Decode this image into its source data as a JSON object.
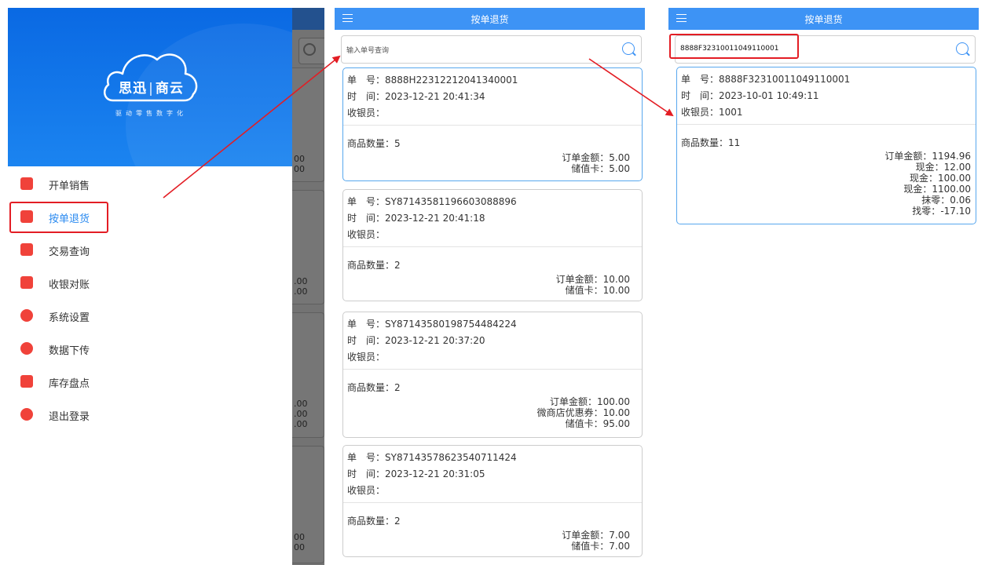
{
  "drawer": {
    "brand": "思迅",
    "brand_separator": "|",
    "product": "商云",
    "slogan": "驱动零售数字化",
    "menu": [
      {
        "label": "开单销售",
        "icon": "store-icon"
      },
      {
        "label": "按单退货",
        "icon": "return-bag-icon"
      },
      {
        "label": "交易查询",
        "icon": "search-bag-icon"
      },
      {
        "label": "收银对账",
        "icon": "cash-register-icon"
      },
      {
        "label": "系统设置",
        "icon": "gear-icon"
      },
      {
        "label": "数据下传",
        "icon": "cloud-download-icon"
      },
      {
        "label": "库存盘点",
        "icon": "inventory-check-icon"
      },
      {
        "label": "退出登录",
        "icon": "logout-icon"
      }
    ],
    "bg_peek_values": [
      "00",
      "00",
      ".00",
      ".00",
      ".00",
      ".00",
      ".00",
      "00",
      "00"
    ]
  },
  "screen_list": {
    "title": "按单退货",
    "search_placeholder": "输入单号查询",
    "orders": [
      {
        "no_label": "单　号：",
        "no": "8888H22312212041340001",
        "time_label": "时　间：",
        "time": "2023-12-21 20:41:34",
        "cashier_label": "收银员：",
        "cashier": "",
        "qty_label": "商品数量：",
        "qty": "5",
        "payments": [
          {
            "label": "订单金额：",
            "value": "5.00"
          },
          {
            "label": "储值卡：",
            "value": "5.00"
          }
        ]
      },
      {
        "no_label": "单　号：",
        "no": "SY87143581196603088896",
        "time_label": "时　间：",
        "time": "2023-12-21 20:41:18",
        "cashier_label": "收银员：",
        "cashier": "",
        "qty_label": "商品数量：",
        "qty": "2",
        "payments": [
          {
            "label": "订单金额：",
            "value": "10.00"
          },
          {
            "label": "储值卡：",
            "value": "10.00"
          }
        ]
      },
      {
        "no_label": "单　号：",
        "no": "SY87143580198754484224",
        "time_label": "时　间：",
        "time": "2023-12-21 20:37:20",
        "cashier_label": "收银员：",
        "cashier": "",
        "qty_label": "商品数量：",
        "qty": "2",
        "payments": [
          {
            "label": "订单金额：",
            "value": "100.00"
          },
          {
            "label": "微商店优惠券：",
            "value": "10.00"
          },
          {
            "label": "储值卡：",
            "value": "95.00"
          }
        ]
      },
      {
        "no_label": "单　号：",
        "no": "SY87143578623540711424",
        "time_label": "时　间：",
        "time": "2023-12-21 20:31:05",
        "cashier_label": "收银员：",
        "cashier": "",
        "qty_label": "商品数量：",
        "qty": "2",
        "payments": [
          {
            "label": "订单金额：",
            "value": "7.00"
          },
          {
            "label": "储值卡：",
            "value": "7.00"
          }
        ]
      }
    ]
  },
  "screen_result": {
    "title": "按单退货",
    "search_value": "8888F32310011049110001",
    "order": {
      "no_label": "单　号：",
      "no": "8888F32310011049110001",
      "time_label": "时　间：",
      "time": "2023-10-01 10:49:11",
      "cashier_label": "收银员：",
      "cashier": "1001",
      "qty_label": "商品数量：",
      "qty": "11",
      "payments": [
        {
          "label": "订单金额：",
          "value": "1194.96"
        },
        {
          "label": "现金：",
          "value": "12.00"
        },
        {
          "label": "现金：",
          "value": "100.00"
        },
        {
          "label": "现金：",
          "value": "1100.00"
        },
        {
          "label": "抹零：",
          "value": "0.06"
        },
        {
          "label": "找零：",
          "value": "-17.10"
        }
      ]
    }
  },
  "colors": {
    "header_blue": "#3d93f5",
    "drawer_blue": "#0a69e3",
    "highlight_red": "#e31d24",
    "menu_icon_red": "#f0423a",
    "active_blue": "#2a8af0"
  }
}
